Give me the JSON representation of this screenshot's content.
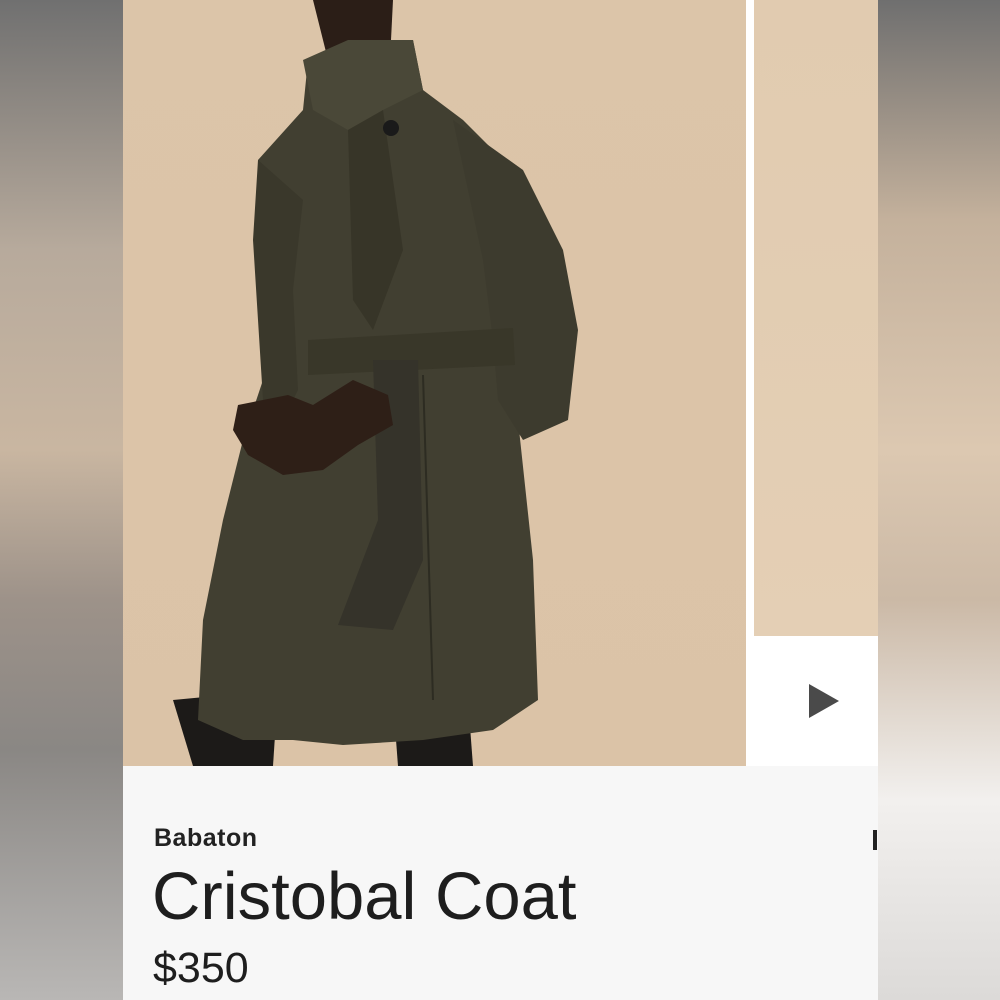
{
  "product": {
    "brand": "Babaton",
    "name": "Cristobal Coat",
    "price": "$350"
  },
  "gallery": {
    "main_image": "model-wearing-coat",
    "next_button_icon": "play-arrow-icon"
  },
  "colors": {
    "backdrop": "#dcc5a9",
    "coat": "#403f30",
    "panel": "#f7f7f7",
    "text": "#1e1e1e"
  }
}
